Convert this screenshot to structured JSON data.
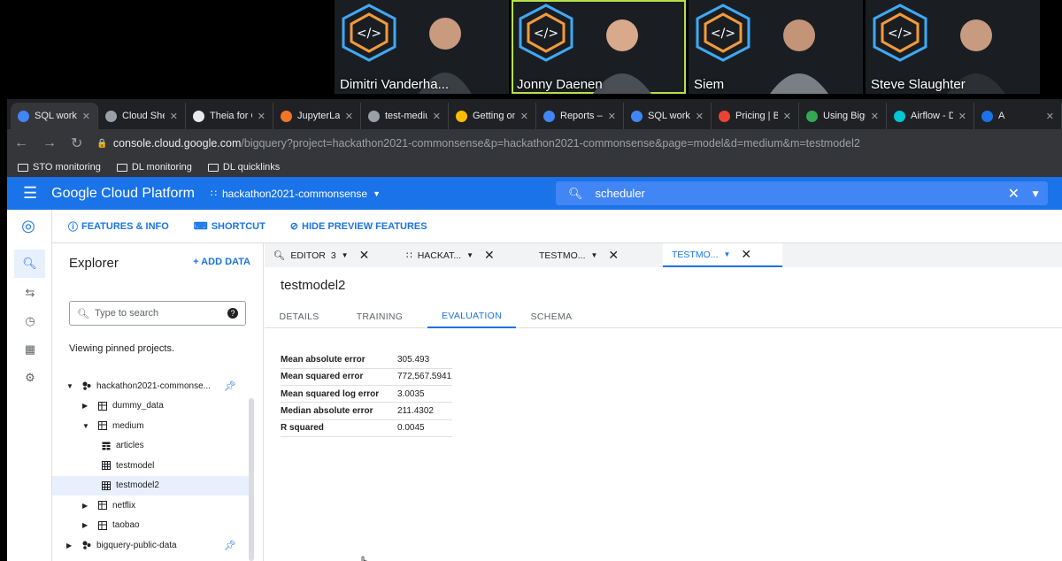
{
  "participants": [
    {
      "name": "Dimitri Vanderha..."
    },
    {
      "name": "Jonny Daenen"
    },
    {
      "name": "Siem"
    },
    {
      "name": "Steve Slaughter"
    }
  ],
  "browser_tabs": [
    {
      "label": "SQL worksp",
      "color": "#4285f4"
    },
    {
      "label": "Cloud Shell",
      "color": "#9aa0a6"
    },
    {
      "label": "Theia for Cl",
      "color": "#e8eaed"
    },
    {
      "label": "JupyterLab",
      "color": "#f37626"
    },
    {
      "label": "test-mediu",
      "color": "#9aa0a6"
    },
    {
      "label": "Getting onl",
      "color": "#fbbc04"
    },
    {
      "label": "Reports – B",
      "color": "#4285f4"
    },
    {
      "label": "SQL worksp",
      "color": "#4285f4"
    },
    {
      "label": "Pricing | B",
      "color": "#ea4335"
    },
    {
      "label": "Using BigQ",
      "color": "#34a853"
    },
    {
      "label": "Airflow - DA",
      "color": "#00c7d4"
    },
    {
      "label": "A",
      "color": "#1a73e8"
    }
  ],
  "address": {
    "host": "console.cloud.google.com",
    "path": "/bigquery?project=hackathon2021-commonsense&p=hackathon2021-commonsense&page=model&d=medium&m=testmodel2"
  },
  "bookmarks": [
    "STO monitoring",
    "DL monitoring",
    "DL quicklinks"
  ],
  "gcp": {
    "title": "Google Cloud Platform",
    "project": "hackathon2021-commonsense",
    "search_value": "scheduler"
  },
  "actions": [
    "FEATURES & INFO",
    "SHORTCUT",
    "HIDE PREVIEW FEATURES"
  ],
  "explorer": {
    "title": "Explorer",
    "add_data": "+ ADD DATA",
    "search_placeholder": "Type to search",
    "pinned_note": "Viewing pinned projects.",
    "tree": [
      {
        "label": "hackathon2021-commonse...",
        "type": "project",
        "depth": 0,
        "expanded": true,
        "pinned": true
      },
      {
        "label": "dummy_data",
        "type": "dataset",
        "depth": 1,
        "expanded": false
      },
      {
        "label": "medium",
        "type": "dataset",
        "depth": 1,
        "expanded": true
      },
      {
        "label": "articles",
        "type": "table",
        "depth": 2
      },
      {
        "label": "testmodel",
        "type": "model",
        "depth": 2
      },
      {
        "label": "testmodel2",
        "type": "model",
        "depth": 2,
        "selected": true
      },
      {
        "label": "netflix",
        "type": "dataset",
        "depth": 1,
        "expanded": false
      },
      {
        "label": "taobao",
        "type": "dataset",
        "depth": 1,
        "expanded": false
      },
      {
        "label": "bigquery-public-data",
        "type": "project",
        "depth": 0,
        "expanded": false,
        "pinned": true
      }
    ]
  },
  "editor_tabs": [
    {
      "label": "EDITOR",
      "count": "3"
    },
    {
      "label": "HACKAT..."
    },
    {
      "label": "TESTMO..."
    },
    {
      "label": "TESTMO...",
      "active": true
    }
  ],
  "model": {
    "title": "testmodel2",
    "tabs": [
      "DETAILS",
      "TRAINING",
      "EVALUATION",
      "SCHEMA"
    ],
    "active_tab": "EVALUATION",
    "evaluation": [
      {
        "metric": "Mean absolute error",
        "value": "305.493"
      },
      {
        "metric": "Mean squared error",
        "value": "772,567.5941"
      },
      {
        "metric": "Mean squared log error",
        "value": "3.0035"
      },
      {
        "metric": "Median absolute error",
        "value": "211.4302"
      },
      {
        "metric": "R squared",
        "value": "0.0045"
      }
    ]
  }
}
